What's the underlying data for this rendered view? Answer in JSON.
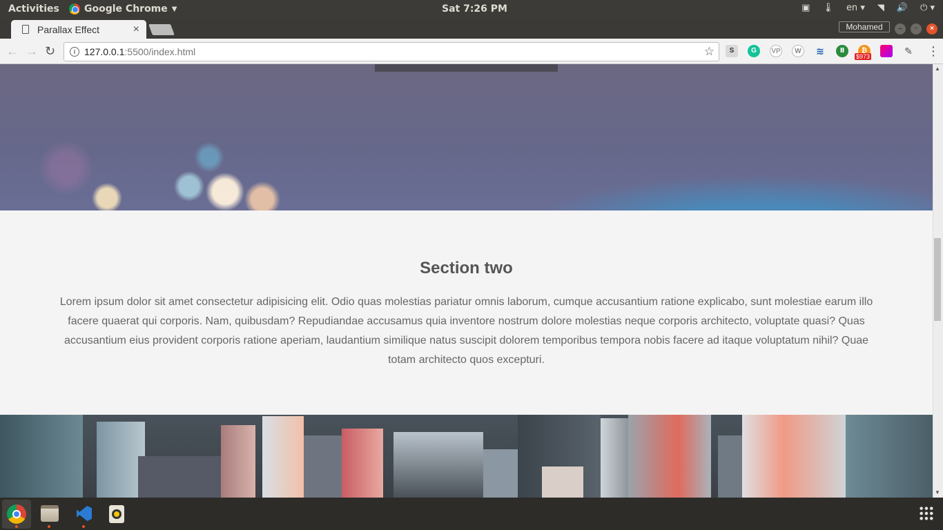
{
  "topbar": {
    "activities": "Activities",
    "app_name": "Google Chrome",
    "clock": "Sat  7:26 PM",
    "language": "en"
  },
  "tab": {
    "title": "Parallax Effect",
    "close": "×"
  },
  "user_badge": "Mohamed",
  "address": {
    "host": "127.0.0.1",
    "path": ":5500/index.html"
  },
  "extensions": {
    "bitcoin_price": "$973"
  },
  "page": {
    "section_title": "Section two",
    "section_body": "Lorem ipsum dolor sit amet consectetur adipisicing elit. Odio quas molestias pariatur omnis laborum, cumque accusantium ratione explicabo, sunt molestiae earum illo facere quaerat qui corporis. Nam, quibusdam? Repudiandae accusamus quia inventore nostrum dolore molestias neque corporis architecto, voluptate quasi? Quas accusantium eius provident corporis ratione aperiam, laudantium similique natus suscipit dolorem temporibus tempora nobis facere ad itaque voluptatum nihil? Quae totam architecto quos excepturi."
  },
  "colors": {
    "ubuntu_orange": "#e95420",
    "grammarly": "#15c39a"
  }
}
